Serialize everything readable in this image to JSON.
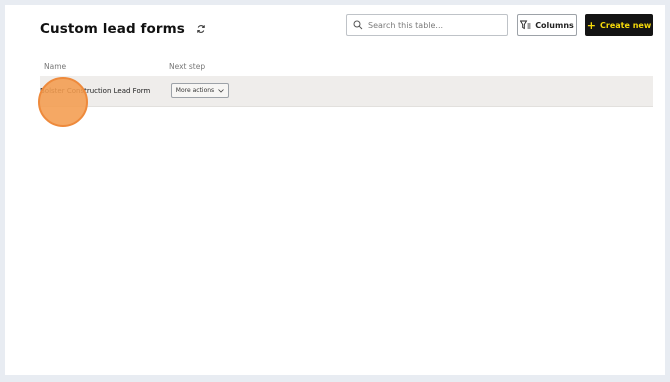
{
  "header": {
    "title": "Custom lead forms",
    "refresh_icon": "refresh-icon"
  },
  "toolbar": {
    "search_placeholder": "Search this table...",
    "search_value": "",
    "columns_label": "Columns",
    "create_label": "Create new"
  },
  "table": {
    "columns": [
      "Name",
      "Next step"
    ],
    "rows": [
      {
        "name": "Bolster Construction Lead Form",
        "action_label": "More actions"
      }
    ]
  },
  "colors": {
    "create_button_bg": "#141414",
    "create_button_text": "#f5d90a",
    "row_bg": "#efedeb",
    "click_marker": "#f49c4e"
  }
}
